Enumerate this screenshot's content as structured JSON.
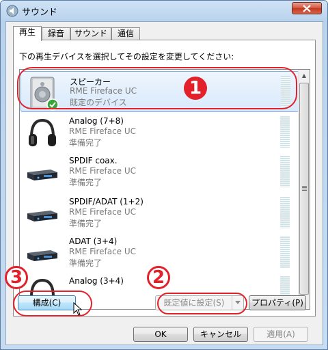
{
  "window": {
    "title": "サウンド"
  },
  "tabs": [
    {
      "label": "再生",
      "active": true
    },
    {
      "label": "録音",
      "active": false
    },
    {
      "label": "サウンド",
      "active": false
    },
    {
      "label": "通信",
      "active": false
    }
  ],
  "instruction": "下の再生デバイスを選択してその設定を変更してください:",
  "devices": [
    {
      "name": "スピーカー",
      "driver": "RME Fireface UC",
      "status": "既定のデバイス",
      "icon": "speaker-icon",
      "selected": true,
      "default": true
    },
    {
      "name": "Analog (7+8)",
      "driver": "RME Fireface UC",
      "status": "準備完了",
      "icon": "headphones-icon",
      "selected": false
    },
    {
      "name": "SPDIF coax.",
      "driver": "RME Fireface UC",
      "status": "準備完了",
      "icon": "audio-interface-icon",
      "selected": false
    },
    {
      "name": "SPDIF/ADAT (1+2)",
      "driver": "RME Fireface UC",
      "status": "準備完了",
      "icon": "audio-interface-icon",
      "selected": false
    },
    {
      "name": "ADAT (3+4)",
      "driver": "RME Fireface UC",
      "status": "準備完了",
      "icon": "audio-interface-icon",
      "selected": false
    },
    {
      "name": "Analog (3+4)",
      "driver": "",
      "status": "",
      "icon": "headphones-icon",
      "selected": false
    }
  ],
  "buttons": {
    "configure": "構成(C)",
    "set_default": "既定値に設定(S)",
    "properties": "プロパティ(P)",
    "ok": "OK",
    "cancel": "キャンセル",
    "apply": "適用(A)"
  },
  "annotations": {
    "n1": "1",
    "n2": "2",
    "n3": "3"
  },
  "colors": {
    "annotation": "#e3212a",
    "selection": "#d8e9fb"
  }
}
